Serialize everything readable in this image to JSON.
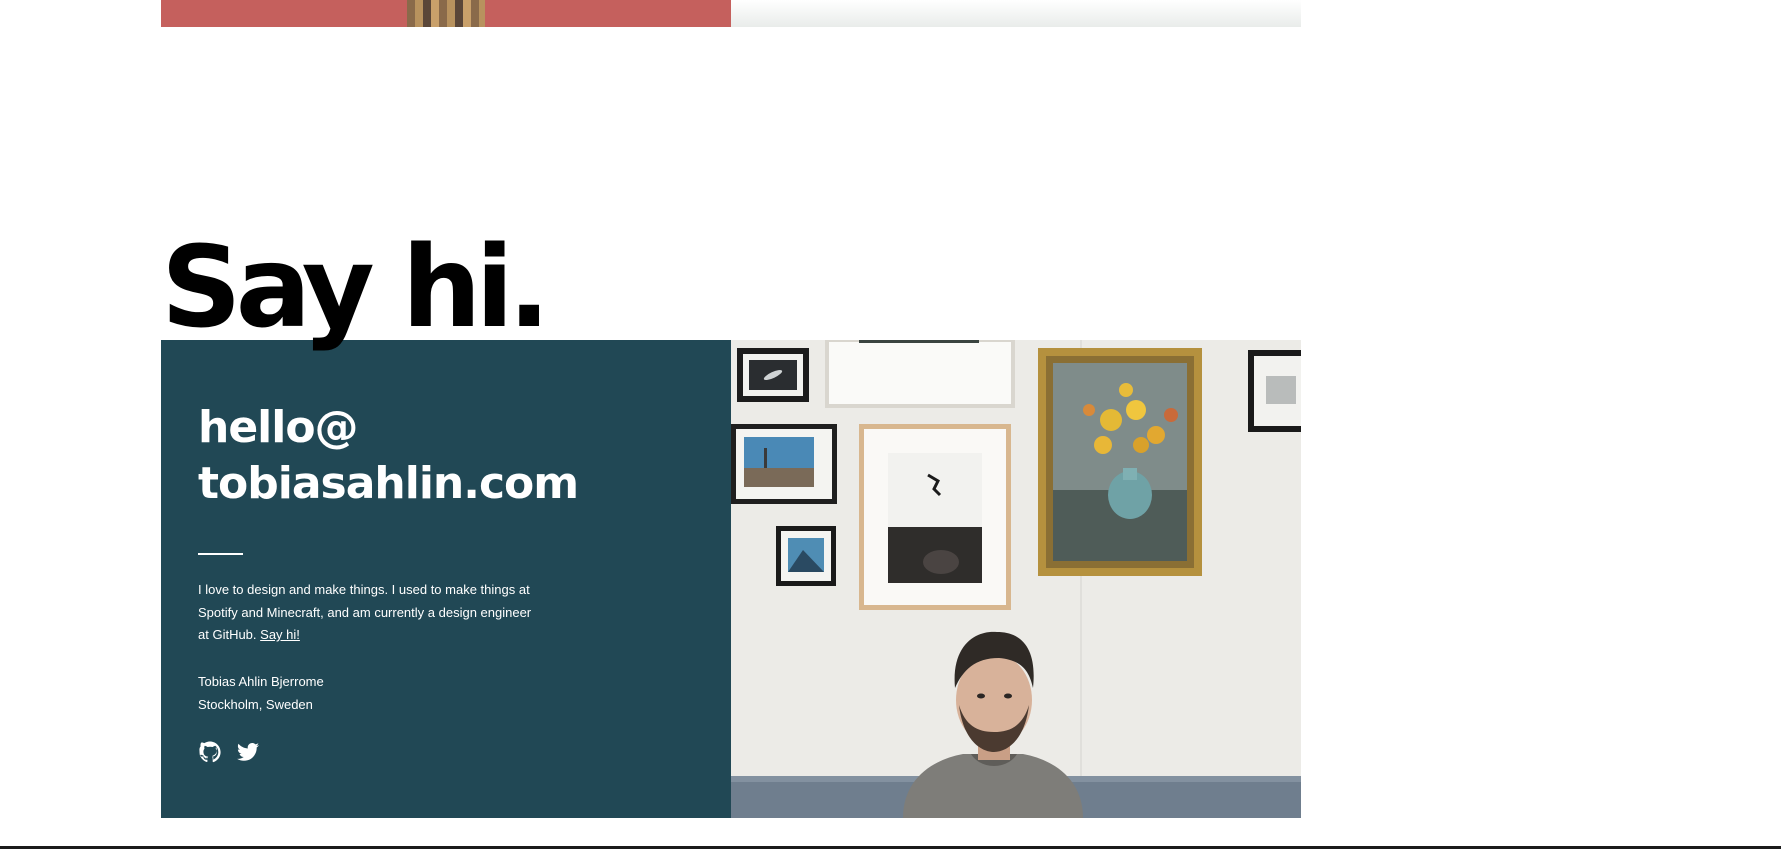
{
  "heading": "Say hi.",
  "contact": {
    "email_line1": "hello@",
    "email_line2": "tobiasahlin.com",
    "bio": "I love to design and make things. I used to make things at Spotify and Minecraft, and am currently a design engineer at GitHub.",
    "say_hi_link": "Say hi!",
    "name": "Tobias Ahlin Bjerrome",
    "location": "Stockholm, Sweden"
  },
  "socials": [
    {
      "icon": "github-icon",
      "label": "GitHub"
    },
    {
      "icon": "twitter-icon",
      "label": "Twitter"
    }
  ],
  "colors": {
    "panel": "#214855",
    "top_strip": "#c5605d",
    "text_light": "#ffffff"
  }
}
